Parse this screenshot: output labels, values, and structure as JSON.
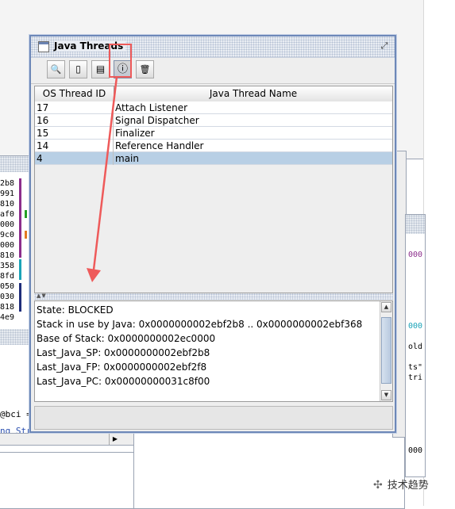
{
  "window": {
    "title": "Java Threads"
  },
  "toolbar": {
    "buttons": [
      {
        "icon": "inspect-icon",
        "glyph": "🔍"
      },
      {
        "icon": "stack-icon",
        "glyph": "▯"
      },
      {
        "icon": "memory-icon",
        "glyph": "▤"
      },
      {
        "icon": "thread-info-icon",
        "glyph": "ⓘ"
      },
      {
        "icon": "trash-icon",
        "glyph": "🗑"
      }
    ]
  },
  "table": {
    "columns": [
      "OS Thread ID",
      "Java Thread Name"
    ],
    "rows": [
      {
        "id": "17",
        "name": "Attach Listener"
      },
      {
        "id": "16",
        "name": "Signal Dispatcher"
      },
      {
        "id": "15",
        "name": "Finalizer"
      },
      {
        "id": "14",
        "name": "Reference Handler"
      },
      {
        "id": "4",
        "name": "main"
      }
    ],
    "selected_index": 4
  },
  "details": {
    "lines": [
      "State: BLOCKED",
      "Stack in use by Java: 0x0000000002ebf2b8 .. 0x0000000002ebf368",
      "Base of Stack: 0x0000000002ec0000",
      "Last_Java_SP: 0x0000000002ebf2b8",
      "Last_Java_FP: 0x0000000002ebf2f8",
      "Last_Java_PC: 0x00000000031c8f00"
    ]
  },
  "background": {
    "left_hex": [
      "2b8",
      "991",
      "810",
      "af0",
      "000",
      "9c0",
      "000",
      "810",
      "358",
      "8fd",
      "050",
      "030",
      "818",
      "4e9"
    ],
    "right_text": [
      "000",
      "000",
      "old",
      "ts\"",
      "tri",
      "000"
    ],
    "bottom_code": [
      "@bci =",
      "ng Str"
    ]
  },
  "watermark": "技术趋势",
  "colors": {
    "annotation": "#ee5a5a",
    "selection": "#b8cfe5",
    "window_border": "#6d88b8"
  }
}
